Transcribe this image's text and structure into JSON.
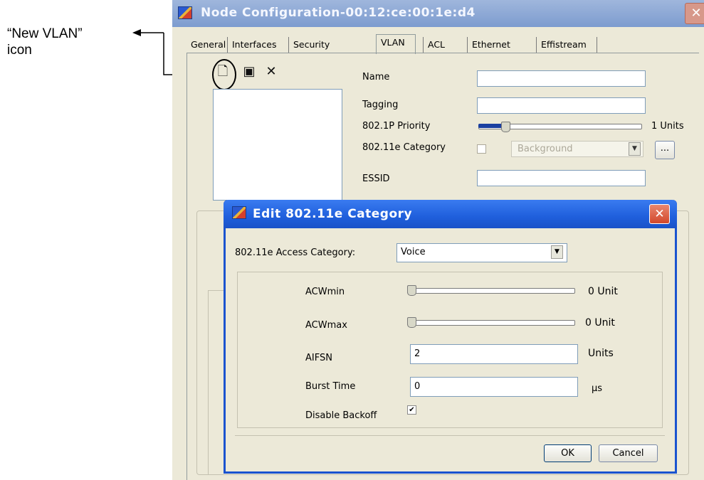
{
  "annotation": {
    "callout_line1": "“New VLAN”",
    "callout_line2": "icon"
  },
  "window": {
    "title": "Node Configuration-00:12:ce:00:1e:d4",
    "close_glyph": "✕",
    "tabs": [
      "General",
      "Interfaces",
      "Security",
      "VLAN",
      "ACL",
      "Ethernet",
      "Effistream"
    ],
    "selected_tab": "VLAN"
  },
  "toolbar": {
    "icons": [
      "new-vlan-icon",
      "save-icon",
      "delete-icon"
    ],
    "new_glyph": "🗋",
    "save_glyph": "▣",
    "delete_glyph": "✕"
  },
  "vlan_form": {
    "name_label": "Name",
    "name_value": "",
    "tagging_label": "Tagging",
    "tagging_value": "",
    "priority_label": "802.1P Priority",
    "priority_value": 1,
    "priority_text": "1 Units",
    "category_label": "802.11e Category",
    "category_checked": false,
    "category_value": "Background",
    "browse_label": "...",
    "essid_label": "ESSID",
    "essid_value": ""
  },
  "dialog": {
    "title": "Edit 802.11e Category",
    "close_glyph": "✕",
    "access_category_label": "802.11e Access Category:",
    "access_category_value": "Voice",
    "acwmin_label": "ACWmin",
    "acwmin_value": 0,
    "acwmin_text": "0 Unit",
    "acwmax_label": "ACWmax",
    "acwmax_value": 0,
    "acwmax_text": "0 Unit",
    "aifsn_label": "AIFSN",
    "aifsn_value": "2",
    "aifsn_unit": "Units",
    "burst_label": "Burst Time",
    "burst_value": "0",
    "burst_unit": "µs",
    "backoff_label": "Disable Backoff",
    "backoff_checked": true,
    "check_glyph": "✔",
    "ok_label": "OK",
    "cancel_label": "Cancel"
  },
  "colors": {
    "dialog_title": "#1f5fdc",
    "window_title": "#7d9ccf",
    "panel_bg": "#ece9d8"
  }
}
